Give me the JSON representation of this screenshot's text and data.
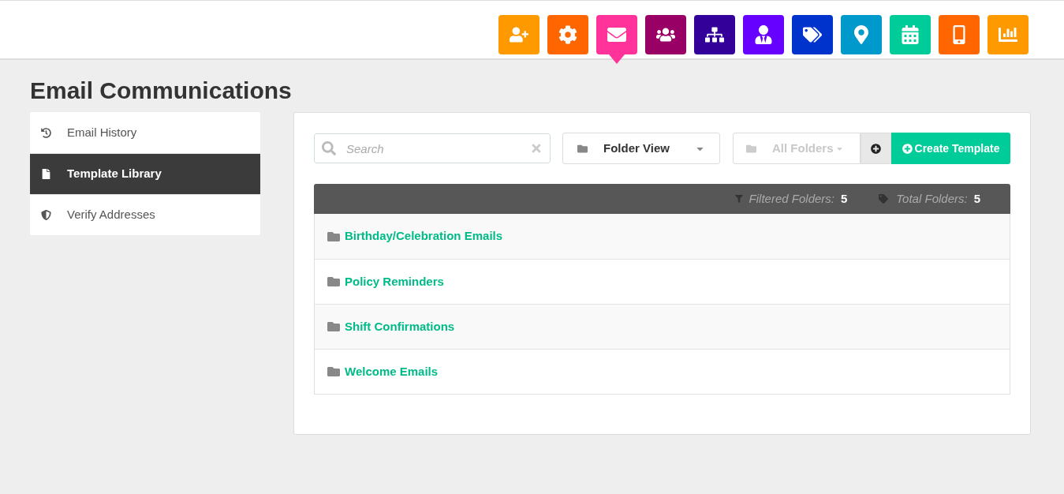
{
  "nav_tiles": [
    {
      "kind": "user-add",
      "color": "#ff9900",
      "selected": false
    },
    {
      "kind": "settings",
      "color": "#ff6600",
      "selected": false
    },
    {
      "kind": "mail",
      "color": "#ff3399",
      "selected": true
    },
    {
      "kind": "users",
      "color": "#990066",
      "selected": false
    },
    {
      "kind": "hierarchy",
      "color": "#330099",
      "selected": false
    },
    {
      "kind": "crown-user",
      "color": "#6600ff",
      "selected": false
    },
    {
      "kind": "tags",
      "color": "#0033cc",
      "selected": false
    },
    {
      "kind": "pin",
      "color": "#0099cc",
      "selected": false
    },
    {
      "kind": "calendar",
      "color": "#00cc99",
      "selected": false
    },
    {
      "kind": "mobile",
      "color": "#ff6600",
      "selected": false
    },
    {
      "kind": "chart",
      "color": "#ff9900",
      "selected": false
    }
  ],
  "page_title": "Email Communications",
  "sidebar": {
    "items": [
      {
        "kind": "history",
        "label": "Email History",
        "selected": false
      },
      {
        "kind": "file",
        "label": "Template Library",
        "selected": true
      },
      {
        "kind": "shield",
        "label": "Verify Addresses",
        "selected": false
      }
    ]
  },
  "toolbar": {
    "search": {
      "placeholder": "Search"
    },
    "view_select": "Folder View",
    "folder_select": "All Folders",
    "create_button": "Create Template"
  },
  "stats": {
    "filtered_label": "Filtered Folders:",
    "filtered_value": "5",
    "total_label": "Total Folders:",
    "total_value": "5"
  },
  "folders": [
    "Birthday/Celebration Emails",
    "Policy Reminders",
    "Shift Confirmations",
    "Welcome Emails"
  ]
}
